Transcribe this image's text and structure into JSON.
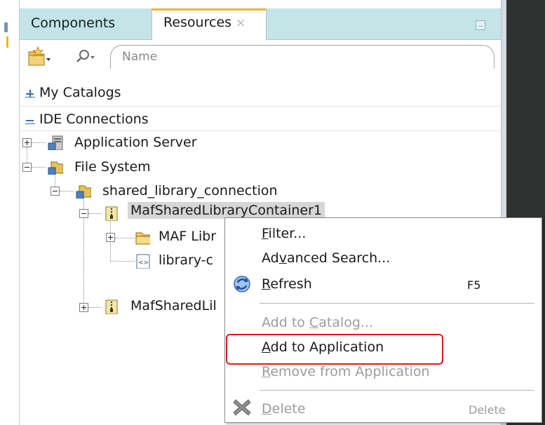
{
  "tabs": {
    "components": "Components",
    "resources": "Resources",
    "close_glyph": "×"
  },
  "search": {
    "placeholder": "Name",
    "value": ""
  },
  "sections": {
    "catalogs": "My Catalogs",
    "ide": "IDE Connections"
  },
  "tree": {
    "application_server": "Application Server",
    "file_system": "File System",
    "connection": "shared_library_connection",
    "container1": "MafSharedLibraryContainer1",
    "maf_libraries": "MAF Libr",
    "library_connection": "library-c",
    "container2": "MafSharedLil"
  },
  "menu": {
    "filter": {
      "pre": "",
      "key": "F",
      "post": "ilter..."
    },
    "advanced_search": {
      "pre": "Ad",
      "key": "v",
      "post": "anced Search..."
    },
    "refresh": {
      "pre": "",
      "key": "R",
      "post": "efresh",
      "shortcut": "F5"
    },
    "add_to_catalog": {
      "pre": "Add to ",
      "key": "C",
      "post": "atalog..."
    },
    "add_to_application": {
      "pre": "",
      "key": "A",
      "post": "dd to Application"
    },
    "remove_from_application": {
      "pre": "",
      "key": "R",
      "post": "emove from Application"
    },
    "delete": {
      "pre": "",
      "key": "D",
      "post": "elete",
      "shortcut": "Delete"
    }
  },
  "colors": {
    "tab_strip": "#c3e5e8",
    "active_tab_accent": "#f0b335",
    "highlight_box": "#e01b1b",
    "editor_dark": "#2f3030"
  },
  "icons": [
    "new-item-icon",
    "search-icon",
    "server-connection-icon",
    "file-system-icon",
    "jar-icon",
    "folder-icon",
    "xml-file-icon",
    "refresh-icon",
    "delete-icon"
  ]
}
